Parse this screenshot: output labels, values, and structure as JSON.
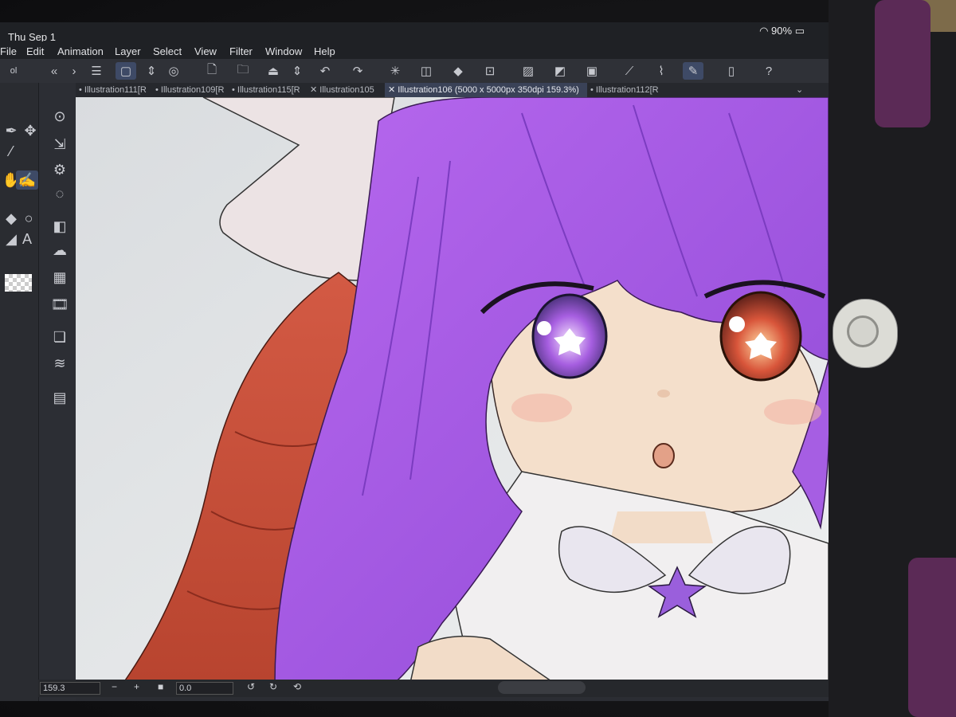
{
  "status": {
    "time": "Thu Sep 1",
    "battery": "90%"
  },
  "menu": [
    "File",
    "Edit",
    "Animation",
    "Layer",
    "Select",
    "View",
    "Filter",
    "Window",
    "Help"
  ],
  "tabs": [
    {
      "label": "Illustration111[R"
    },
    {
      "label": "Illustration109[R"
    },
    {
      "label": "Illustration115[R"
    },
    {
      "label": "Illustration105"
    },
    {
      "label": "Illustration106 (5000 x 5000px 350dpi 159.3%)"
    },
    {
      "label": "Illustration112[R"
    }
  ],
  "bottom": {
    "zoom": "159.3",
    "rotation": "0.0"
  },
  "left_panel_label": "ol",
  "colors": {
    "accent": "#3e4a66",
    "hair_purple": "#a45ce0",
    "hair_red": "#c9503a",
    "skin": "#f3dfcb"
  },
  "icons": {
    "pen": "pen-icon",
    "move": "move-icon",
    "eyedropper": "eyedropper-icon",
    "hand": "hand-icon",
    "fill": "fill-icon",
    "text": "text-icon",
    "undo": "undo-icon",
    "redo": "redo-icon"
  }
}
